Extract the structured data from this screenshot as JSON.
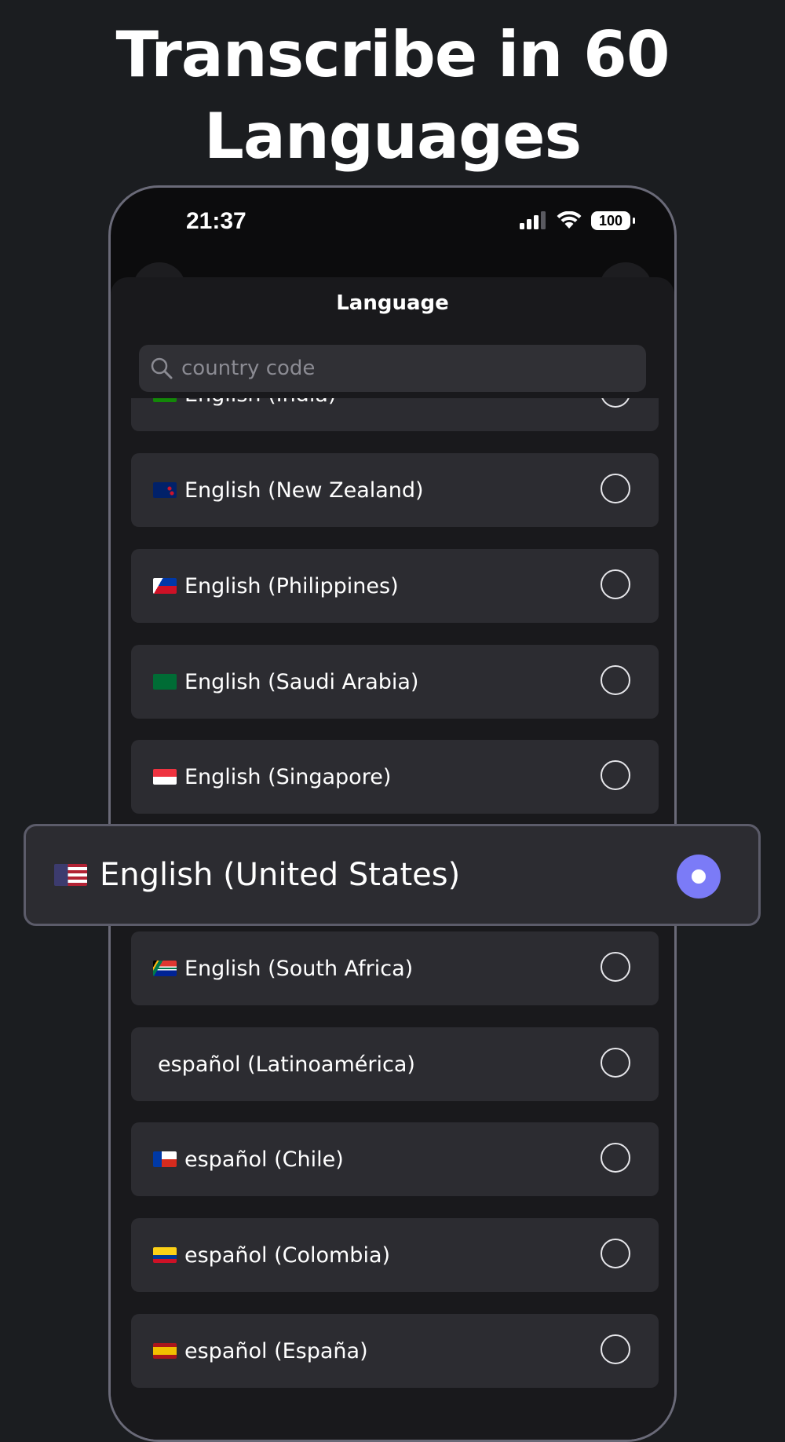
{
  "headline": "Transcribe in 60 Languages",
  "status_bar": {
    "time": "21:37",
    "battery": "100"
  },
  "sheet": {
    "title": "Language",
    "search_placeholder": "country code"
  },
  "languages": [
    {
      "label": "English (India)",
      "flag": "india-flag-icon",
      "selected": false
    },
    {
      "label": "English (New Zealand)",
      "flag": "new-zealand-flag-icon",
      "selected": false
    },
    {
      "label": "English (Philippines)",
      "flag": "philippines-flag-icon",
      "selected": false
    },
    {
      "label": "English (Saudi Arabia)",
      "flag": "saudi-arabia-flag-icon",
      "selected": false
    },
    {
      "label": "English (Singapore)",
      "flag": "singapore-flag-icon",
      "selected": false
    },
    {
      "label": "English (United States)",
      "flag": "united-states-flag-icon",
      "selected": true
    },
    {
      "label": "English (South Africa)",
      "flag": "south-africa-flag-icon",
      "selected": false
    },
    {
      "label": "español (Latinoamérica)",
      "flag": "",
      "selected": false
    },
    {
      "label": "español (Chile)",
      "flag": "chile-flag-icon",
      "selected": false
    },
    {
      "label": "español (Colombia)",
      "flag": "colombia-flag-icon",
      "selected": false
    },
    {
      "label": "español (España)",
      "flag": "spain-flag-icon",
      "selected": false
    }
  ],
  "colors": {
    "background": "#1b1d20",
    "row": "#2c2c31",
    "accent": "#7b7bf7"
  }
}
